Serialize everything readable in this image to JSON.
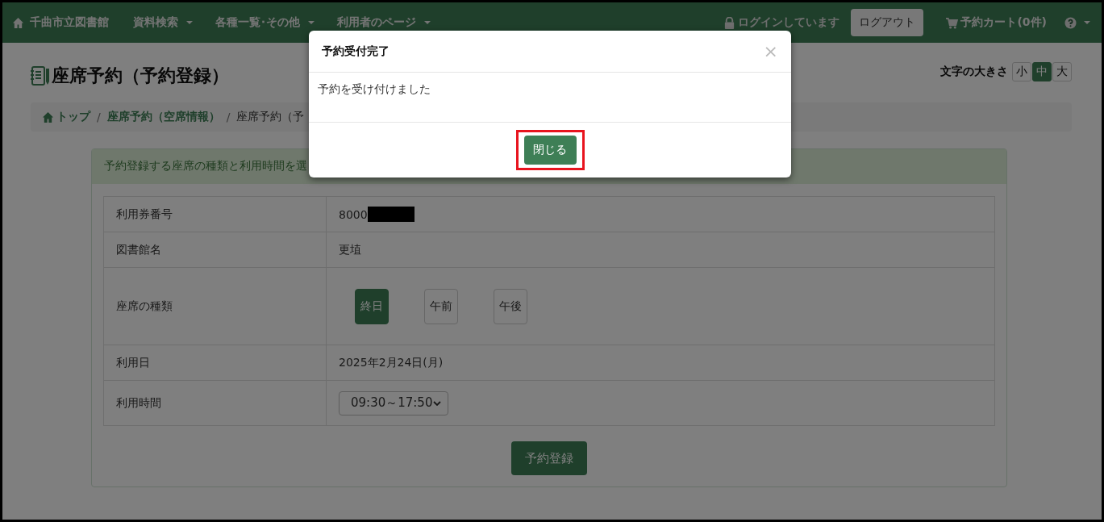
{
  "navbar": {
    "brand": "千曲市立図書館",
    "menus": [
      "資料検索",
      "各種一覧･その他",
      "利用者のページ"
    ],
    "login_status": "ログインしています",
    "logout": "ログアウト",
    "cart": "予約カート(0件)"
  },
  "page_title": "座席予約（予約登録）",
  "font_size": {
    "label": "文字の大きさ",
    "options": [
      {
        "label": "小",
        "selected": false
      },
      {
        "label": "中",
        "selected": true
      },
      {
        "label": "大",
        "selected": false
      }
    ]
  },
  "breadcrumb": [
    {
      "label": "トップ",
      "kind": "home"
    },
    {
      "separator": "/",
      "label": "座席予約（空席情報）",
      "kind": "link"
    },
    {
      "separator": "/",
      "label": "座席予約（予",
      "kind": "current"
    }
  ],
  "panel": {
    "heading": "予約登録する座席の種類と利用時間を選",
    "rows": [
      {
        "label": "利用券番号",
        "kind": "redacted",
        "value": "8000"
      },
      {
        "label": "図書館名",
        "kind": "text",
        "value": "更埴"
      },
      {
        "label": "座席の種類",
        "kind": "choices",
        "options": [
          {
            "label": "終日",
            "selected": true
          },
          {
            "label": "午前",
            "selected": false
          },
          {
            "label": "午後",
            "selected": false
          }
        ]
      },
      {
        "label": "利用日",
        "kind": "text",
        "value": "2025年2月24日(月)"
      },
      {
        "label": "利用時間",
        "kind": "select",
        "value": "09:30～17:50"
      }
    ],
    "submit": "予約登録"
  },
  "modal": {
    "title": "予約受付完了",
    "message": "予約を受け付けました",
    "close_glyph": "×",
    "button": "閉じる",
    "button_highlighted": true
  }
}
